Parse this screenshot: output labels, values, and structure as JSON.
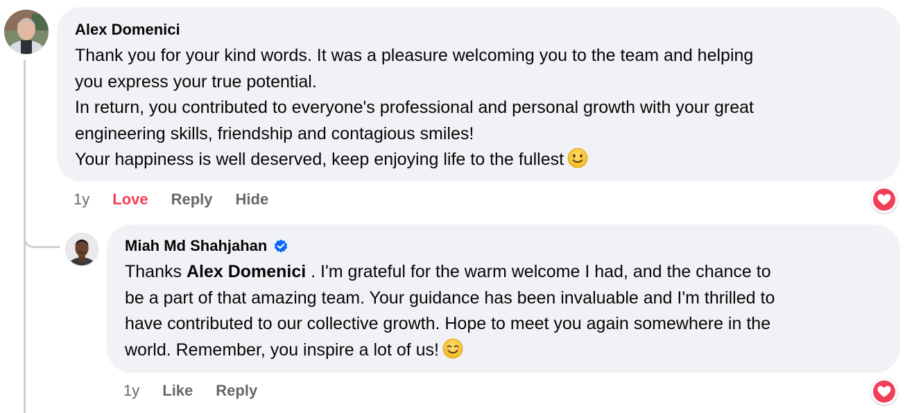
{
  "thread": {
    "comment": {
      "author": "Alex Domenici",
      "lines": [
        "Thank you for your kind words. It was a pleasure welcoming you to the team and helping",
        "you express your true potential.",
        "In return, you contributed to everyone's professional and personal growth with your great",
        "engineering skills, friendship and contagious smiles!",
        "Your happiness is well deserved, keep enjoying life to the fullest"
      ],
      "emoji_icon": "slightly-smiling-face-icon",
      "actions": {
        "timestamp": "1y",
        "reaction": "Love",
        "reply": "Reply",
        "hide": "Hide"
      },
      "reaction_icon": "love-heart-icon",
      "colors": {
        "love": "#f33e58"
      }
    },
    "reply": {
      "author": "Miah Md Shahjahan",
      "verified": true,
      "text_prefix": "Thanks ",
      "mention": "Alex Domenici",
      "text_after_mention": " . I'm grateful for the warm welcome I had, and the chance to",
      "lines": [
        "be a part of that amazing team. Your guidance has been invaluable and I'm thrilled to",
        "have contributed to our collective growth. Hope to meet you again somewhere in the",
        "world. Remember, you inspire a lot of us!"
      ],
      "emoji_icon": "smiling-face-with-smiling-eyes-icon",
      "actions": {
        "timestamp": "1y",
        "like": "Like",
        "reply": "Reply"
      },
      "reaction_icon": "love-heart-icon",
      "colors": {
        "verified": "#0866ff"
      }
    }
  }
}
